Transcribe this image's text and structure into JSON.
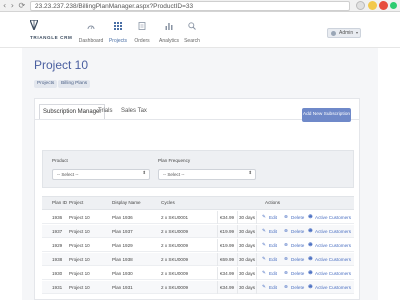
{
  "browser": {
    "url": "23.23.237.238/BillingPlanManager.aspx?ProductID=33",
    "nav_glyph": "‹ › ⟳"
  },
  "header": {
    "logo_text": "TRIANGLE CRM",
    "nav": [
      {
        "label": "Dashboard",
        "icon": "dashboard-icon"
      },
      {
        "label": "Projects",
        "icon": "projects-grid-icon"
      },
      {
        "label": "Orders",
        "icon": "orders-icon"
      },
      {
        "label": "Analytics",
        "icon": "analytics-icon"
      },
      {
        "label": "Search",
        "icon": "search-icon"
      }
    ],
    "user": {
      "label": "Admin",
      "caret": "▾"
    }
  },
  "page": {
    "title": "Project 10",
    "breadcrumb": [
      "Projects",
      "Billing Plans"
    ]
  },
  "tabs": [
    "Subscription Manager",
    "Trials",
    "Sales Tax"
  ],
  "add_button": "Add New Subscription",
  "filters": {
    "product_label": "Product",
    "product_value": "-- Select --",
    "frequency_label": "Plan Frequency",
    "frequency_value": "-- Select --",
    "caret": "⬍"
  },
  "table": {
    "headers": [
      "Plan ID",
      "Project",
      "Display Name",
      "Cycles",
      "Actions"
    ],
    "rows": [
      {
        "plan_id": "1936",
        "project": "Project 10",
        "display_name": "Plan 1936",
        "cycles": "2 x SKU0001",
        "price": "€34.99",
        "days": "30 days"
      },
      {
        "plan_id": "1937",
        "project": "Project 10",
        "display_name": "Plan 1937",
        "cycles": "2 x SKU0009",
        "price": "€19.99",
        "days": "30 days"
      },
      {
        "plan_id": "1929",
        "project": "Project 10",
        "display_name": "Plan 1929",
        "cycles": "2 x SKU0009",
        "price": "€19.99",
        "days": "30 days"
      },
      {
        "plan_id": "1938",
        "project": "Project 10",
        "display_name": "Plan 1938",
        "cycles": "2 x SKU0009",
        "price": "€69.99",
        "days": "30 days"
      },
      {
        "plan_id": "1930",
        "project": "Project 10",
        "display_name": "Plan 1930",
        "cycles": "2 x SKU0009",
        "price": "€34.99",
        "days": "30 days"
      },
      {
        "plan_id": "1931",
        "project": "Project 10",
        "display_name": "Plan 1931",
        "cycles": "2 x SKU0009",
        "price": "€34.99",
        "days": "30 days"
      }
    ],
    "actions": {
      "edit": "Edit",
      "delete": "Delete",
      "customers": "Active Customers"
    }
  },
  "colors": {
    "accent": "#4a6fc2",
    "title": "#4a5fa0",
    "button": "#6f89c9"
  }
}
